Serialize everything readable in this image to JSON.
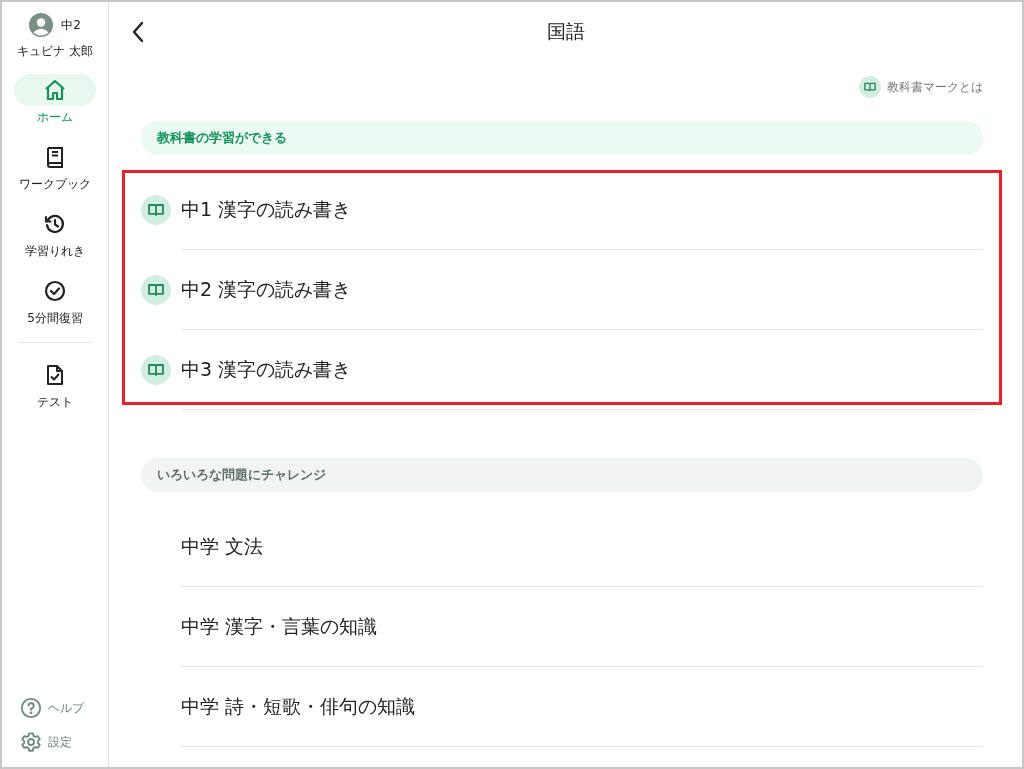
{
  "user": {
    "grade": "中2",
    "name": "キュビナ 太郎"
  },
  "nav": [
    {
      "label": "ホーム",
      "selected": true
    },
    {
      "label": "ワークブック",
      "selected": false
    },
    {
      "label": "学習りれき",
      "selected": false
    },
    {
      "label": "5分間復習",
      "selected": false
    }
  ],
  "nav_secondary": [
    {
      "label": "テスト",
      "selected": false
    }
  ],
  "footer_links": [
    {
      "label": "ヘルプ"
    },
    {
      "label": "設定"
    }
  ],
  "header": {
    "title": "国語"
  },
  "textbook_mark_link": "教科書マークとは",
  "sections": [
    {
      "kind": "textbook",
      "heading": "教科書の学習ができる",
      "highlighted": true,
      "items": [
        {
          "label": "中1 漢字の読み書き",
          "textbook": true
        },
        {
          "label": "中2 漢字の読み書き",
          "textbook": true
        },
        {
          "label": "中3 漢字の読み書き",
          "textbook": true
        }
      ]
    },
    {
      "kind": "challenge",
      "heading": "いろいろな問題にチャレンジ",
      "highlighted": false,
      "items": [
        {
          "label": "中学 文法",
          "textbook": false
        },
        {
          "label": "中学 漢字・言葉の知識",
          "textbook": false
        },
        {
          "label": "中学 詩・短歌・俳句の知識",
          "textbook": false
        }
      ]
    }
  ]
}
